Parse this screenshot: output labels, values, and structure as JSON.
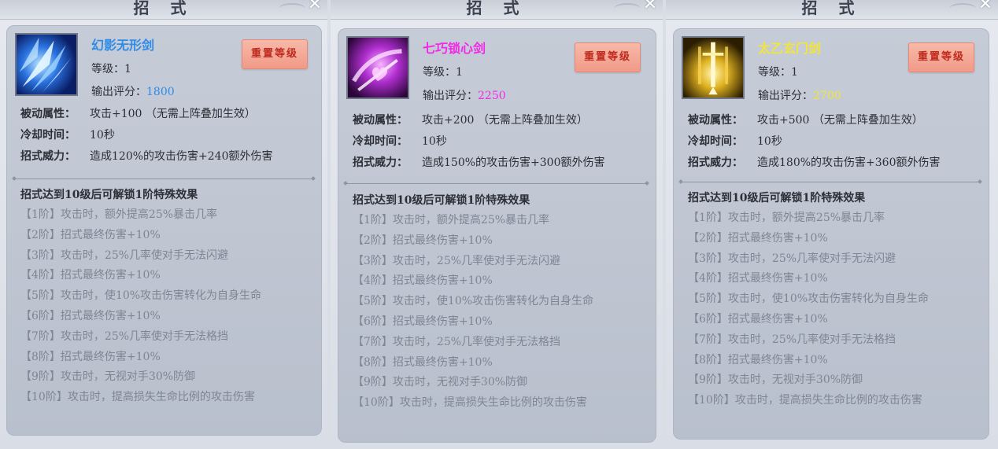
{
  "panel_title": "招 式",
  "close_glyph": "✕",
  "labels": {
    "level": "等级：",
    "score": "输出评分：",
    "reset": "重置等级",
    "passive": "被动属性：",
    "cooldown": "冷却时间：",
    "power": "招式威力：",
    "unlock": "招式达到10级后可解锁1阶特殊效果"
  },
  "colors": {
    "blue": "#2f8be8",
    "magenta": "#f02ae6",
    "gold": "#f1e53a",
    "tier_text": "#7f8593"
  },
  "skills": [
    {
      "name": "幻影无形剑",
      "icon": "blue-ice-shards-icon",
      "level": "1",
      "score": "1800",
      "passive": "攻击+100 （无需上阵叠加生效）",
      "cooldown": "10秒",
      "power": "造成120%的攻击伤害+240额外伤害"
    },
    {
      "name": "七巧锁心剑",
      "icon": "purple-heart-sword-icon",
      "level": "1",
      "score": "2250",
      "passive": "攻击+200 （无需上阵叠加生效）",
      "cooldown": "10秒",
      "power": "造成150%的攻击伤害+300额外伤害"
    },
    {
      "name": "太乙玄门剑",
      "icon": "golden-sword-gate-icon",
      "level": "1",
      "score": "2700",
      "passive": "攻击+500 （无需上阵叠加生效）",
      "cooldown": "10秒",
      "power": "造成180%的攻击伤害+360额外伤害"
    }
  ],
  "tiers": [
    "【1阶】攻击时，额外提高25%暴击几率",
    "【2阶】招式最终伤害+10%",
    "【3阶】攻击时，25%几率使对手无法闪避",
    "【4阶】招式最终伤害+10%",
    "【5阶】攻击时，使10%攻击伤害转化为自身生命",
    "【6阶】招式最终伤害+10%",
    "【7阶】攻击时，25%几率使对手无法格挡",
    "【8阶】招式最终伤害+10%",
    "【9阶】攻击时，无视对手30%防御",
    "【10阶】攻击时，提高损失生命比例的攻击伤害"
  ]
}
